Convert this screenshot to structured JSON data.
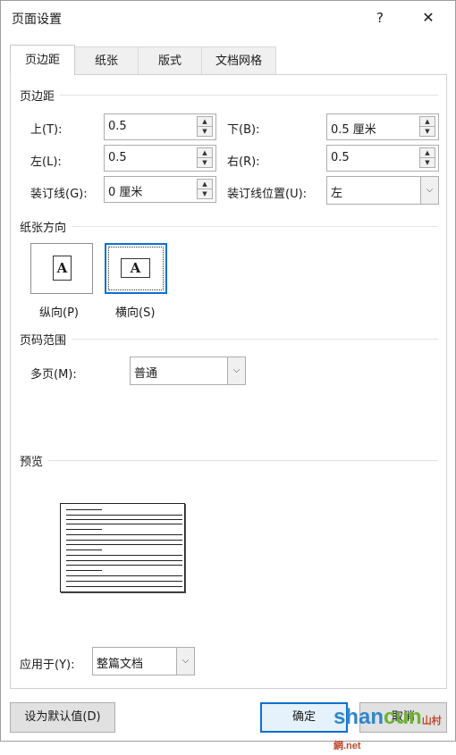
{
  "window": {
    "title": "页面设置",
    "help": "?",
    "close": "✕"
  },
  "tabs": [
    {
      "label": "页边距",
      "active": true
    },
    {
      "label": "纸张",
      "active": false
    },
    {
      "label": "版式",
      "active": false
    },
    {
      "label": "文档网格",
      "active": false
    }
  ],
  "margins": {
    "section": "页边距",
    "top": {
      "label": "上(T):",
      "value": "0.5"
    },
    "bottom": {
      "label": "下(B):",
      "value": "0.5 厘米"
    },
    "left": {
      "label": "左(L):",
      "value": "0.5"
    },
    "right": {
      "label": "右(R):",
      "value": "0.5"
    },
    "gutter": {
      "label": "装订线(G):",
      "value": "0 厘米"
    },
    "gutter_pos": {
      "label": "装订线位置(U):",
      "value": "左"
    }
  },
  "orientation": {
    "section": "纸张方向",
    "portrait": "纵向(P)",
    "landscape": "横向(S)",
    "selected": "landscape",
    "icon_letter": "A"
  },
  "pages": {
    "section": "页码范围",
    "multiple_label": "多页(M):",
    "multiple_value": "普通"
  },
  "preview": {
    "section": "预览"
  },
  "apply": {
    "label": "应用于(Y):",
    "value": "整篇文档"
  },
  "buttons": {
    "default": "设为默认值(D)",
    "ok": "确定",
    "cancel": "取消"
  },
  "watermark": {
    "main1": "shan",
    "main2": "cun",
    "small": "山村網",
    "net": ".net"
  },
  "colors": {
    "accent": "#0f6fd0",
    "button_bg": "#e1e1e1"
  }
}
